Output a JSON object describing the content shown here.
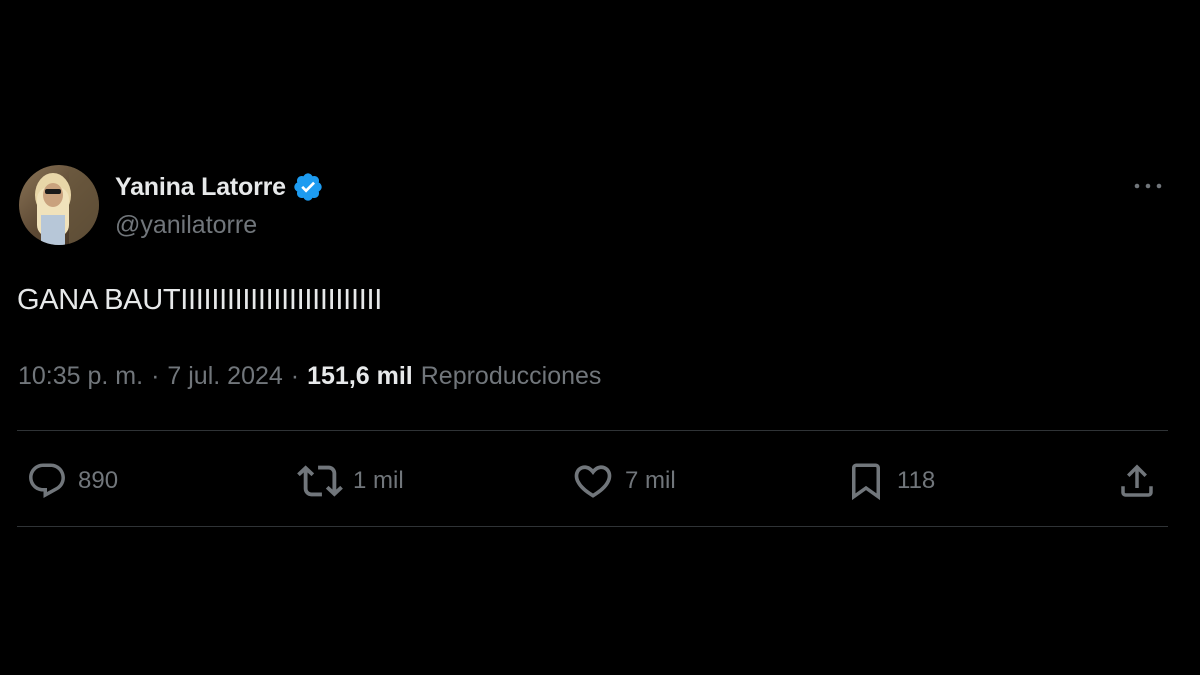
{
  "tweet": {
    "author": {
      "display_name": "Yanina Latorre",
      "handle": "@yanilatorre",
      "verified": true
    },
    "text": "GANA BAUTIIIIIIIIIIIIIIIIIIIIIIIIII",
    "meta": {
      "time": "10:35 p. m.",
      "separator": "·",
      "date": "7 jul. 2024",
      "views_count": "151,6 mil",
      "views_label": "Reproducciones"
    },
    "actions": {
      "replies": "890",
      "reposts": "1 mil",
      "likes": "7 mil",
      "bookmarks": "118"
    },
    "icons": [
      "verified-badge-icon",
      "more-options-icon",
      "reply-icon",
      "repost-icon",
      "like-icon",
      "bookmark-icon",
      "share-icon"
    ]
  },
  "colors": {
    "background": "#000000",
    "primary_text": "#e7e9ea",
    "secondary_text": "#71767b",
    "verified_blue": "#1d9bf0",
    "divider": "#2f3336"
  }
}
